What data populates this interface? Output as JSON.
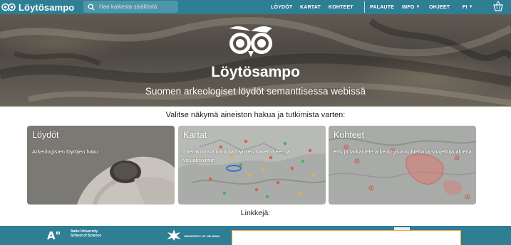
{
  "header": {
    "title": "Löytösampo",
    "search_placeholder": "Hae kaikesta sisällöstä",
    "nav_main": [
      "LÖYDÖT",
      "KARTAT",
      "KOHTEET"
    ],
    "nav_secondary": {
      "palaute": "PALAUTE",
      "info": "INFO",
      "ohjeet": "OHJEET",
      "language": "FI"
    }
  },
  "hero": {
    "title": "Löytösampo",
    "subtitle": "Suomen arkeologiset löydöt semanttisessa webissä"
  },
  "main": {
    "select_heading": "Valitse näkymä aineiston hakua ja tutkimista varten:",
    "cards": [
      {
        "title": "Löydöt",
        "description": "Arkeologisten löytöjen haku"
      },
      {
        "title": "Kartat",
        "description": "Interaktiivisia karttoja löytöjen hakemiseen ja visualisointiin"
      },
      {
        "title": "Kohteet",
        "description": "Etsi ja tarkastele arkeologisia kohteita ja suojeltuja alueita"
      }
    ],
    "links_heading": "Linkkejä:"
  },
  "footer": {
    "aalto_mark": "A\"",
    "aalto_line1": "Aalto University",
    "aalto_line2": "School of Science",
    "uh_text": "UNIVERSITY OF HELSINKI"
  },
  "colors": {
    "primary": "#2e7e94",
    "search_bg": "#4d95a8",
    "footer_box_border": "#f2a23a"
  },
  "icons": {
    "brand": "owl-eyes-icon",
    "search": "search-icon",
    "info_dropdown": "chevron-down-icon",
    "language_dropdown": "chevron-down-icon",
    "top_right": "basket-icon",
    "hero_logo": "owl-eyes-icon"
  }
}
